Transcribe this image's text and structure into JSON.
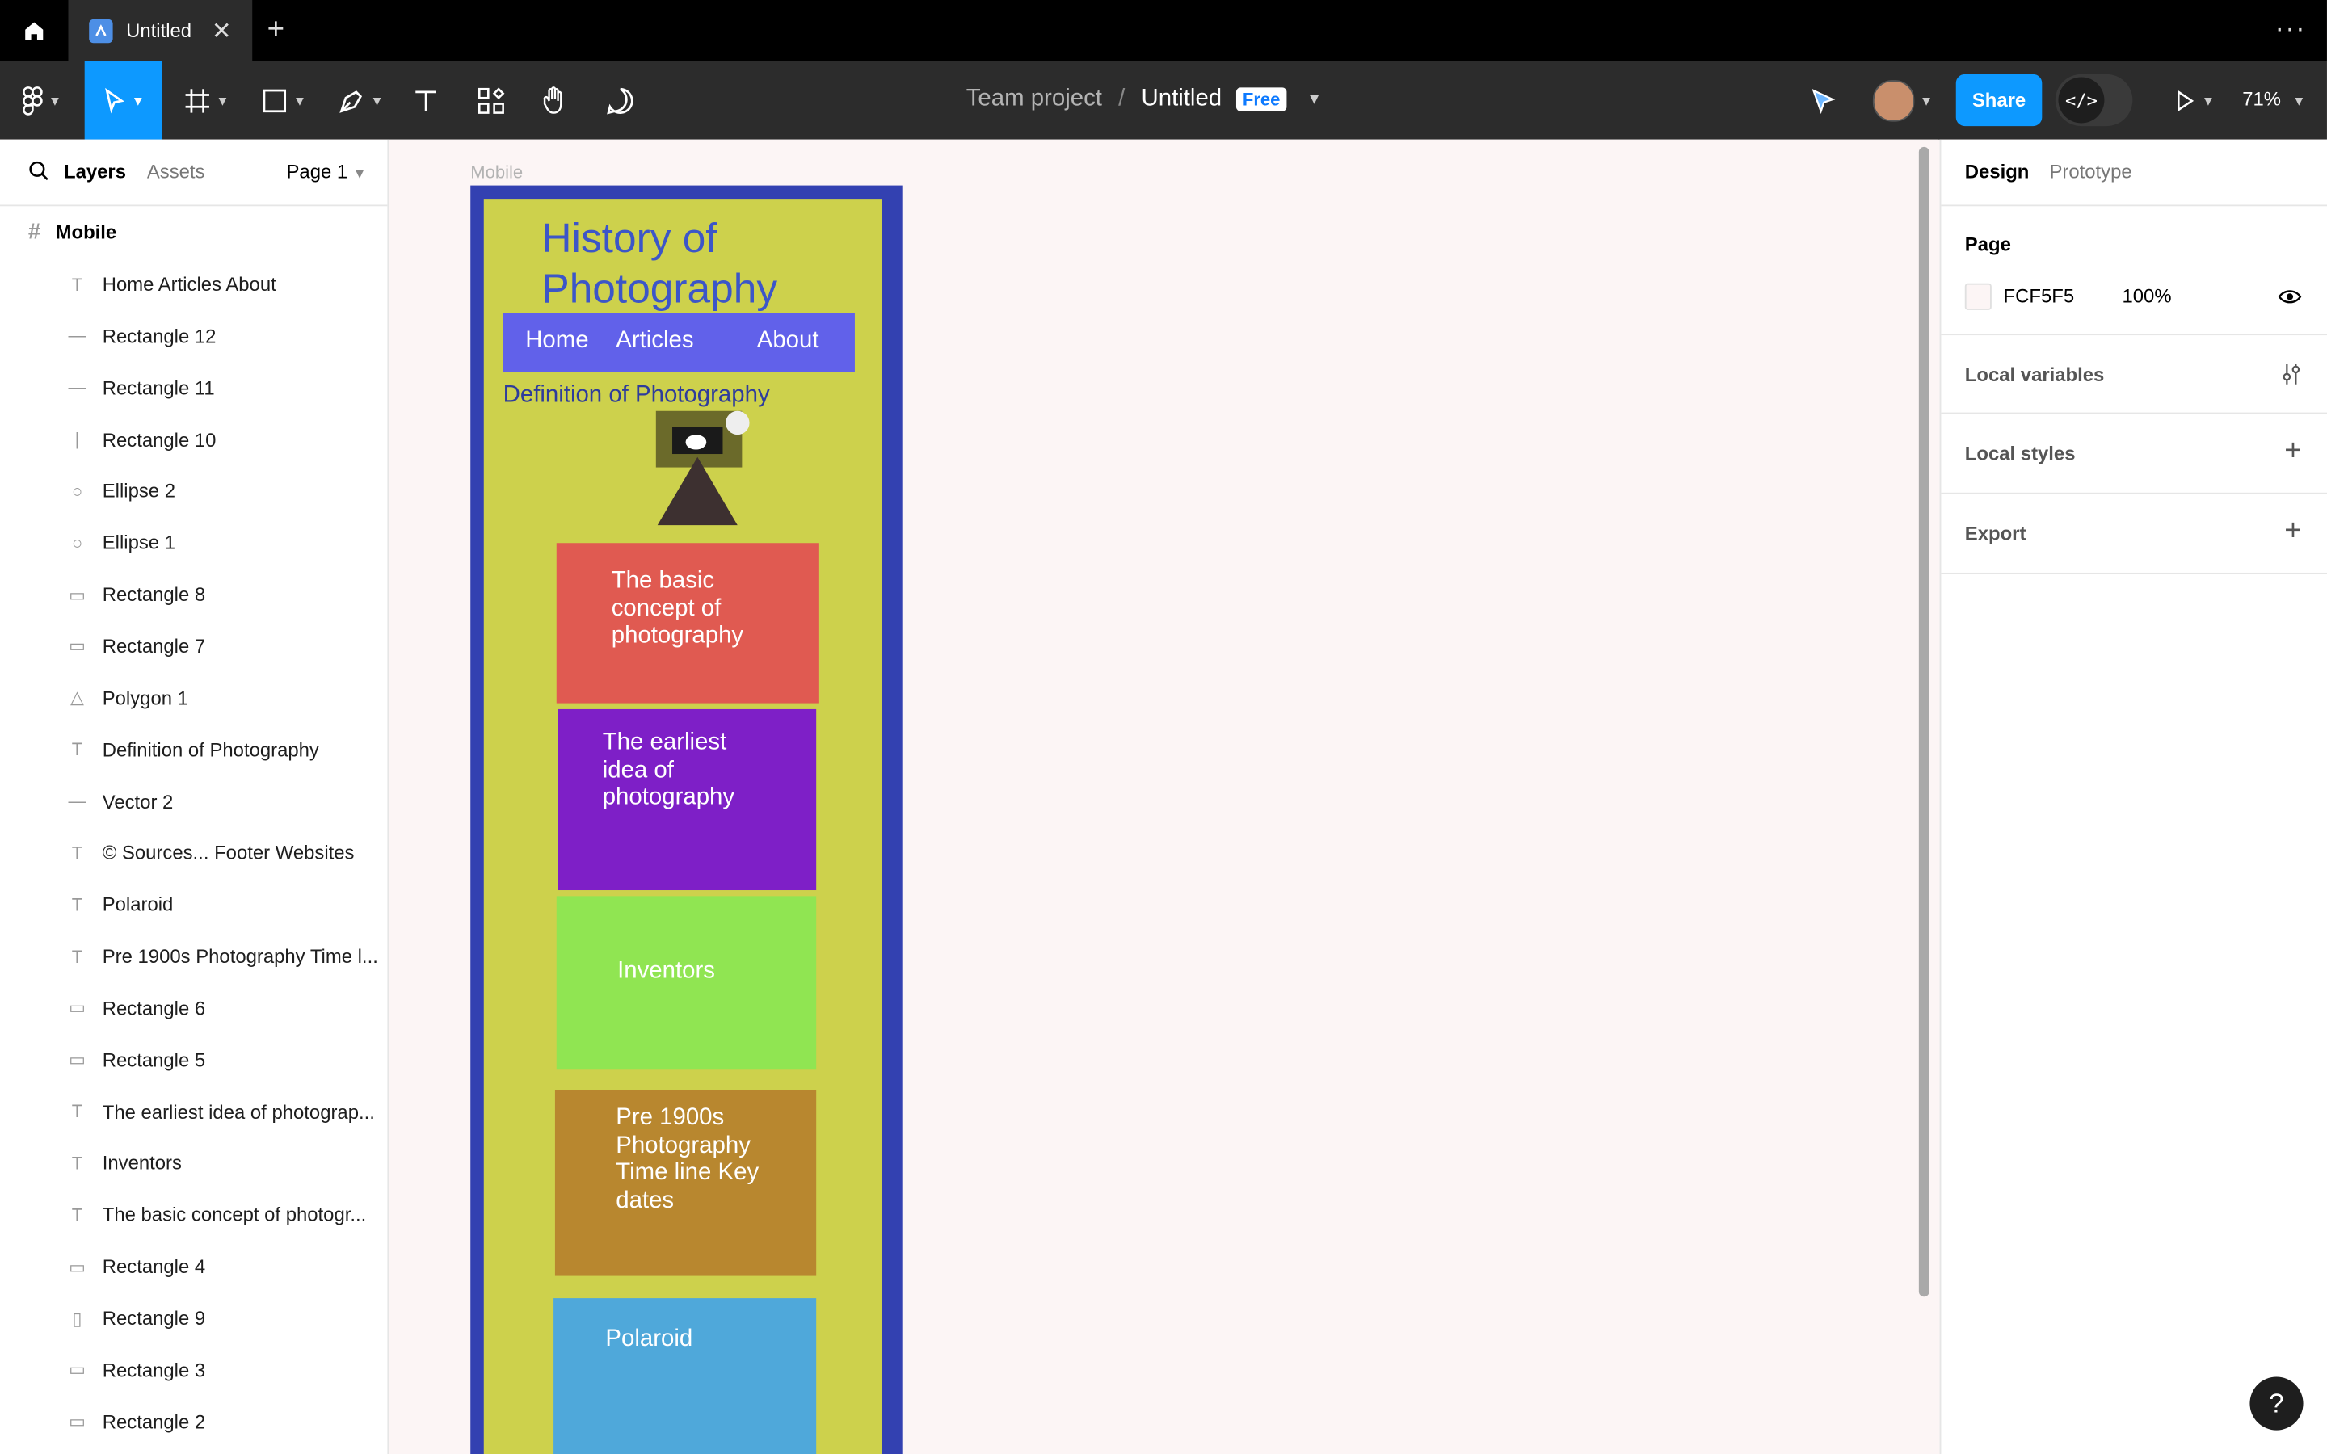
{
  "tab": {
    "title": "Untitled",
    "close": "✕",
    "new": "+"
  },
  "more": "···",
  "breadcrumb": {
    "team": "Team project",
    "sep": "/",
    "file": "Untitled",
    "plan": "Free"
  },
  "share_label": "Share",
  "dev_label": "</>",
  "zoom": "71%",
  "left_panel": {
    "tab_layers": "Layers",
    "tab_assets": "Assets",
    "page": "Page 1",
    "frame": "Mobile",
    "layers": [
      {
        "label": "Home Articles About",
        "icon": "text-icon"
      },
      {
        "label": "Rectangle 12",
        "icon": "line-icon"
      },
      {
        "label": "Rectangle 11",
        "icon": "line-icon"
      },
      {
        "label": "Rectangle 10",
        "icon": "vertical-line-icon"
      },
      {
        "label": "Ellipse 2",
        "icon": "ellipse-icon"
      },
      {
        "label": "Ellipse 1",
        "icon": "ellipse-icon"
      },
      {
        "label": "Rectangle 8",
        "icon": "rectangle-icon"
      },
      {
        "label": "Rectangle 7",
        "icon": "rectangle-icon"
      },
      {
        "label": "Polygon 1",
        "icon": "polygon-icon"
      },
      {
        "label": "Definition of Photography",
        "icon": "text-icon"
      },
      {
        "label": "Vector 2",
        "icon": "line-icon"
      },
      {
        "label": "© Sources... Footer Websites",
        "icon": "text-icon"
      },
      {
        "label": "Polaroid",
        "icon": "text-icon"
      },
      {
        "label": "Pre 1900s Photography Time l...",
        "icon": "text-icon"
      },
      {
        "label": "Rectangle 6",
        "icon": "rectangle-icon"
      },
      {
        "label": "Rectangle 5",
        "icon": "rectangle-icon"
      },
      {
        "label": "The earliest idea of photograp...",
        "icon": "text-icon"
      },
      {
        "label": "Inventors",
        "icon": "text-icon"
      },
      {
        "label": "The basic concept of photogr...",
        "icon": "text-icon"
      },
      {
        "label": "Rectangle 4",
        "icon": "rectangle-icon"
      },
      {
        "label": "Rectangle 9",
        "icon": "tall-rectangle-icon"
      },
      {
        "label": "Rectangle 3",
        "icon": "rectangle-icon"
      },
      {
        "label": "Rectangle 2",
        "icon": "rectangle-icon"
      }
    ]
  },
  "canvas": {
    "frame_label": "Mobile",
    "site_title": "History of Photography",
    "nav": {
      "home": "Home",
      "articles": "Articles",
      "about": "About"
    },
    "definition": "Definition of Photography",
    "cards": [
      {
        "text": "The basic concept of photography",
        "color": "#e05a51"
      },
      {
        "text": "The earliest idea of photography",
        "color": "#7e1fc7"
      },
      {
        "text": "Inventors",
        "color": "#90e552"
      },
      {
        "text": "Pre 1900s Photography Time line Key dates",
        "color": "#b8872f"
      },
      {
        "text": "Polaroid",
        "color": "#4fa8da"
      }
    ]
  },
  "right_panel": {
    "tab_design": "Design",
    "tab_prototype": "Prototype",
    "page_section": "Page",
    "page_color": "FCF5F5",
    "page_opacity": "100%",
    "local_variables": "Local variables",
    "local_styles": "Local styles",
    "export": "Export"
  },
  "help": "?"
}
